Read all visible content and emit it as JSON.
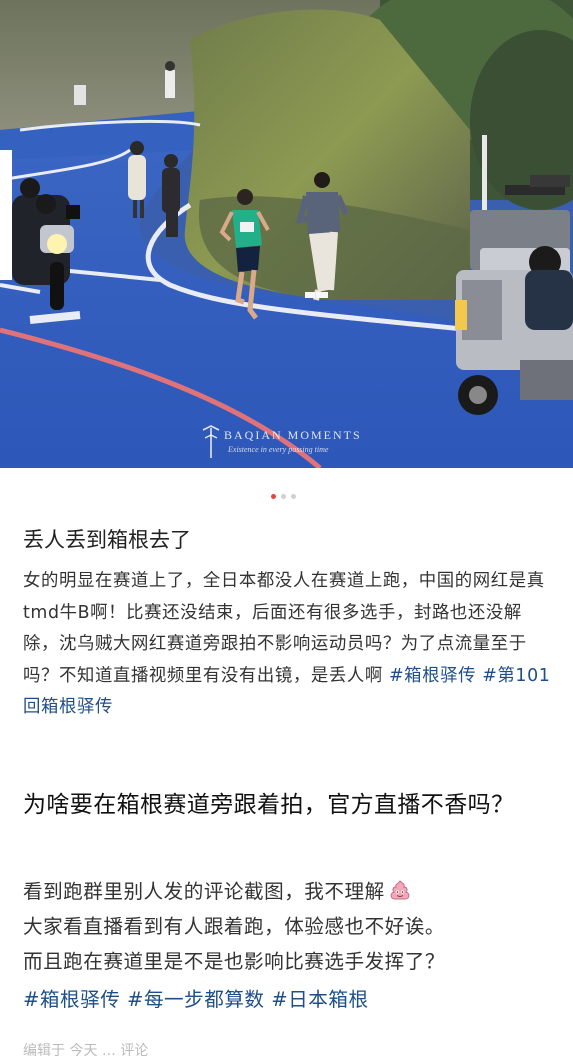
{
  "photo": {
    "watermark_brand": "BAQIAN MOMENTS",
    "watermark_tagline": "Existence in every passing time"
  },
  "carousel": {
    "count": 3,
    "active": 0
  },
  "post1": {
    "title": "丢人丢到箱根去了",
    "body": "女的明显在赛道上了，全日本都没人在赛道上跑，中国的网红是真tmd牛B啊！比赛还没结束，后面还有很多选手，封路也还没解除，沈乌贼大网红赛道旁跟拍不影响运动员吗？为了点流量至于吗？不知道直播视频里有没有出镜，是丢人啊",
    "tags": [
      "#箱根驿传",
      "#第101回箱根驿传"
    ]
  },
  "post2": {
    "title": "为啥要在箱根赛道旁跟着拍，官方直播不香吗？",
    "line1": "看到跑群里别人发的评论截图，我不理解",
    "line2": "大家看直播看到有人跟着跑，体验感也不好诶。",
    "line3": "而且跑在赛道里是不是也影响比赛选手发挥了？",
    "tags": [
      "#箱根驿传",
      "#每一步都算数",
      "#日本箱根"
    ]
  },
  "footer": {
    "text": "编辑于 今天 … 评论"
  },
  "colors": {
    "hashtag": "#1f4f86",
    "dot_active": "#e8453c",
    "dot_inactive": "#d0d0d0"
  }
}
